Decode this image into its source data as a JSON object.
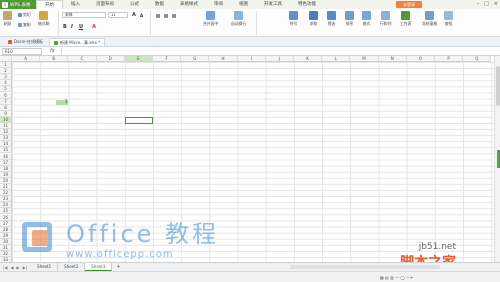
{
  "app": {
    "name": "WPS 表格",
    "login": "未登录"
  },
  "menu": [
    "开始",
    "插入",
    "页面布局",
    "公式",
    "数据",
    "表格样式",
    "审阅",
    "视图",
    "开发工具",
    "特色功能"
  ],
  "ribbon": {
    "paste": "粘贴",
    "cut": "剪切",
    "copy": "复制",
    "format_painter": "格式刷",
    "font": "宋体",
    "size": "11",
    "merge": "合并居中",
    "wrap": "自动换行",
    "symbol": "符号",
    "sum": "求和",
    "filter": "筛选",
    "sort": "排序",
    "format": "格式",
    "rowcol": "行和列",
    "worksheet": "工作表",
    "freeze": "冻结窗格",
    "find": "查找"
  },
  "doc_tabs": [
    {
      "label": "Docer-在线模板",
      "active": false
    },
    {
      "label": "新建 Micro...溝.xlsx *",
      "active": true
    }
  ],
  "formula_bar": {
    "cell_ref": "E10",
    "fx": "fx",
    "content": ""
  },
  "columns": [
    "A",
    "B",
    "C",
    "D",
    "E",
    "F",
    "G",
    "H",
    "I",
    "J",
    "K",
    "L",
    "M",
    "N",
    "O",
    "P",
    "Q"
  ],
  "selected_col": "E",
  "rows": [
    "1",
    "2",
    "3",
    "4",
    "5",
    "6",
    "7",
    "8",
    "9",
    "10",
    "11",
    "12",
    "13",
    "14",
    "15",
    "16",
    "17",
    "18",
    "19",
    "20",
    "21",
    "22",
    "23",
    "24",
    "25",
    "26",
    "27",
    "28",
    "29",
    "30",
    "31",
    "32",
    "33"
  ],
  "selected_row": "10",
  "cells": [
    {
      "ref": "B7",
      "value": "3"
    }
  ],
  "sheets": [
    {
      "label": "Sheet1",
      "active": false
    },
    {
      "label": "Sheet2",
      "active": false
    },
    {
      "label": "Sheet3",
      "active": true
    }
  ],
  "watermark": {
    "title": "Office 教程",
    "url": "www.officepp.com",
    "site_url": "jb51.net",
    "site_name": "脚本之家"
  }
}
